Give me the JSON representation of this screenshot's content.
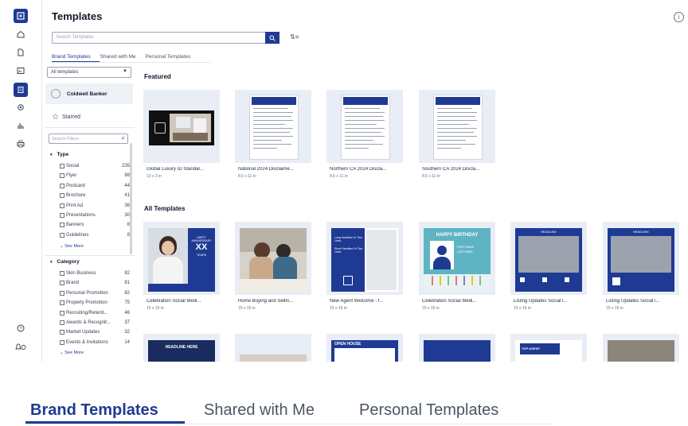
{
  "header": {
    "title": "Templates"
  },
  "search": {
    "placeholder": "Search Templates"
  },
  "tabs": [
    "Brand Templates",
    "Shared with Me",
    "Personal Templates"
  ],
  "filter": {
    "select_value": "All templates",
    "brand": "Coldwell Banker",
    "starred": "Starred",
    "search_placeholder": "Search Filters",
    "type": {
      "heading": "Type",
      "items": [
        {
          "label": "Social",
          "count": "235"
        },
        {
          "label": "Flyer",
          "count": "88"
        },
        {
          "label": "Postcard",
          "count": "44"
        },
        {
          "label": "Brochure",
          "count": "41"
        },
        {
          "label": "Print Ad",
          "count": "36"
        },
        {
          "label": "Presentations",
          "count": "30"
        },
        {
          "label": "Banners",
          "count": "8"
        },
        {
          "label": "Guidelines",
          "count": "8"
        }
      ],
      "see_more": "See More"
    },
    "category": {
      "heading": "Category",
      "items": [
        {
          "label": "Skin Business",
          "count": "82"
        },
        {
          "label": "Brand",
          "count": "81"
        },
        {
          "label": "Personal Promotion",
          "count": "82"
        },
        {
          "label": "Property Promotion",
          "count": "75"
        },
        {
          "label": "Recruiting/Retenti...",
          "count": "46"
        },
        {
          "label": "Awards & Recognit...",
          "count": "37"
        },
        {
          "label": "Market Updates",
          "count": "32"
        },
        {
          "label": "Events & Invitations",
          "count": "14"
        }
      ],
      "see_more": "See More"
    }
  },
  "featured": {
    "heading": "Featured",
    "cards": [
      {
        "name": "Global Luxury ID Standar...",
        "size": "10 x 3 in"
      },
      {
        "name": "National 2024 Disclaime...",
        "size": "8.5 x 11 in"
      },
      {
        "name": "Northern CA 2024 Discla...",
        "size": "8.5 x 11 in"
      },
      {
        "name": "Southern CA 2024 Discla...",
        "size": "8.5 x 11 in"
      }
    ]
  },
  "all": {
    "heading": "All Templates",
    "cards": [
      {
        "name": "Celebration Social Medi...",
        "size": "15 x 15 in",
        "thumb_texts": [
          "HAPPY ANNIVERSARY",
          "XX",
          "YEARS"
        ]
      },
      {
        "name": "Home Buying and Sellin...",
        "size": "15 x 15 in",
        "thumb_texts": []
      },
      {
        "name": "New Agent Welcome - f...",
        "size": "15 x 15 in",
        "thumb_texts": [
          "Long Headline Or Two Lines",
          "Short Headline Or Two Lines"
        ]
      },
      {
        "name": "Celebration Social Medi...",
        "size": "15 x 15 in",
        "thumb_texts": [
          "HAPPY BIRTHDAY",
          "FIRST NAME",
          "LAST NAME"
        ]
      },
      {
        "name": "Listing Updates Social l...",
        "size": "15 x 15 in",
        "thumb_texts": [
          "HEADLINE"
        ]
      },
      {
        "name": "Listing Updates Social l...",
        "size": "15 x 15 in",
        "thumb_texts": [
          "HEADLINE"
        ]
      }
    ],
    "row3": [
      {
        "thumb_texts": [
          "HEADLINE HERE"
        ]
      },
      {
        "thumb_texts": []
      },
      {
        "thumb_texts": [
          "OPEN HOUSE"
        ]
      },
      {
        "thumb_texts": []
      },
      {
        "thumb_texts": [
          "TOP AGENT"
        ]
      },
      {
        "thumb_texts": []
      }
    ]
  },
  "colors": {
    "accent": "#1f3a93",
    "card_bg": "#e8edf6",
    "teal": "#5fb4c4"
  }
}
